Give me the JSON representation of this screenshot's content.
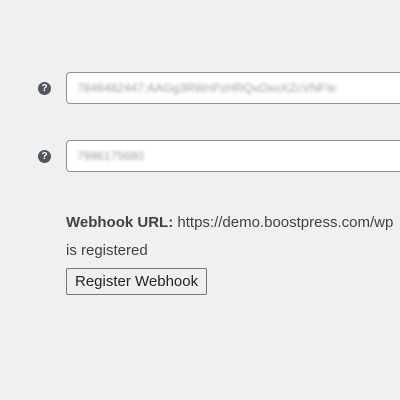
{
  "fields": {
    "bot_token": {
      "value": "7846482447:AAGg3RWnPzHRQxOxoXZcVNFIe"
    },
    "chat_id": {
      "value": "7996175680"
    }
  },
  "webhook": {
    "label": "Webhook URL:",
    "url": " https://demo.boostpress.com/wp",
    "status": "is registered",
    "button_label": "Register Webhook"
  },
  "icons": {
    "help_glyph": "?"
  }
}
